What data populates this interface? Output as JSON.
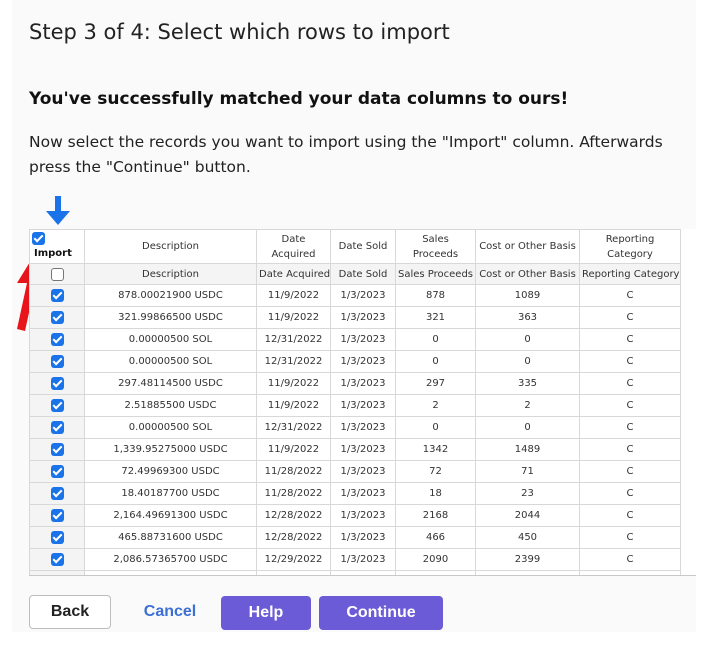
{
  "page": {
    "step_title": "Step 3 of 4: Select which rows to import",
    "success_message": "You've successfully matched your data columns to ours!",
    "instruction": "Now select the records you want to import using the \"Import\" column. Afterwards press the \"Continue\" button."
  },
  "table": {
    "header_import_label": "Import",
    "header_import_checked": true,
    "headers": [
      "Description",
      "Date Acquired",
      "Date Sold",
      "Sales Proceeds",
      "Cost or Other Basis",
      "Reporting Category"
    ],
    "subheaders": [
      "Description",
      "Date Acquired",
      "Date Sold",
      "Sales Proceeds",
      "Cost or Other Basis",
      "Reporting Category"
    ],
    "subheader_import_checked": false,
    "rows": [
      {
        "checked": true,
        "cells": [
          "878.00021900 USDC",
          "11/9/2022",
          "1/3/2023",
          "878",
          "1089",
          "C"
        ]
      },
      {
        "checked": true,
        "cells": [
          "321.99866500 USDC",
          "11/9/2022",
          "1/3/2023",
          "321",
          "363",
          "C"
        ]
      },
      {
        "checked": true,
        "cells": [
          "0.00000500 SOL",
          "12/31/2022",
          "1/3/2023",
          "0",
          "0",
          "C"
        ]
      },
      {
        "checked": true,
        "cells": [
          "0.00000500 SOL",
          "12/31/2022",
          "1/3/2023",
          "0",
          "0",
          "C"
        ]
      },
      {
        "checked": true,
        "cells": [
          "297.48114500 USDC",
          "11/9/2022",
          "1/3/2023",
          "297",
          "335",
          "C"
        ]
      },
      {
        "checked": true,
        "cells": [
          "2.51885500 USDC",
          "11/9/2022",
          "1/3/2023",
          "2",
          "2",
          "C"
        ]
      },
      {
        "checked": true,
        "cells": [
          "0.00000500 SOL",
          "12/31/2022",
          "1/3/2023",
          "0",
          "0",
          "C"
        ]
      },
      {
        "checked": true,
        "cells": [
          "1,339.95275000 USDC",
          "11/9/2022",
          "1/3/2023",
          "1342",
          "1489",
          "C"
        ]
      },
      {
        "checked": true,
        "cells": [
          "72.49969300 USDC",
          "11/28/2022",
          "1/3/2023",
          "72",
          "71",
          "C"
        ]
      },
      {
        "checked": true,
        "cells": [
          "18.40187700 USDC",
          "11/28/2022",
          "1/3/2023",
          "18",
          "23",
          "C"
        ]
      },
      {
        "checked": true,
        "cells": [
          "2,164.49691300 USDC",
          "12/28/2022",
          "1/3/2023",
          "2168",
          "2044",
          "C"
        ]
      },
      {
        "checked": true,
        "cells": [
          "465.88731600 USDC",
          "12/28/2022",
          "1/3/2023",
          "466",
          "450",
          "C"
        ]
      },
      {
        "checked": true,
        "cells": [
          "2,086.57365700 USDC",
          "12/29/2022",
          "1/3/2023",
          "2090",
          "2399",
          "C"
        ]
      },
      {
        "checked": true,
        "cells": [
          "",
          "",
          "",
          "",
          "",
          ""
        ]
      }
    ]
  },
  "buttons": {
    "back": "Back",
    "cancel": "Cancel",
    "help": "Help",
    "continue": "Continue"
  },
  "annotations": {
    "blue_arrow_icon": "arrow-down-icon",
    "red_arrow_icon": "arrow-up-icon",
    "blue_color": "#1a73e8",
    "red_color": "#e8141c"
  },
  "colors": {
    "primary_button": "#6b5bd6",
    "link": "#3b6fd4",
    "checkbox": "#1a73e8"
  }
}
